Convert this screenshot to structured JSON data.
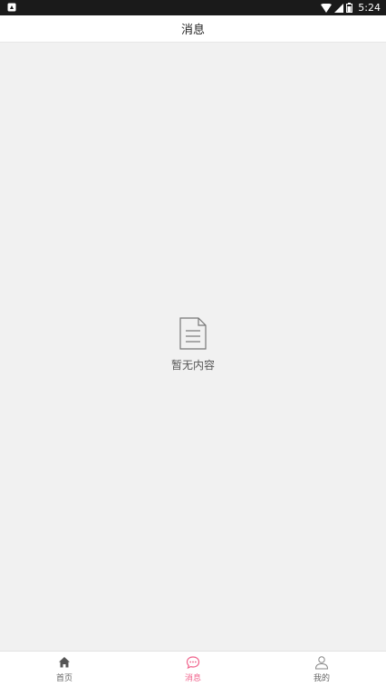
{
  "status_bar": {
    "time": "5:24",
    "icons": [
      "notification-icon",
      "wifi-icon",
      "signal-icon",
      "battery-icon"
    ]
  },
  "header": {
    "title": "消息"
  },
  "empty_state": {
    "icon": "document-icon",
    "message": "暂无内容"
  },
  "tab_bar": {
    "active_color": "#f0628b",
    "inactive_color": "#666666",
    "tabs": [
      {
        "label": "首页",
        "icon": "home-icon",
        "active": false
      },
      {
        "label": "消息",
        "icon": "chat-icon",
        "active": true
      },
      {
        "label": "我的",
        "icon": "user-icon",
        "active": false
      }
    ]
  }
}
